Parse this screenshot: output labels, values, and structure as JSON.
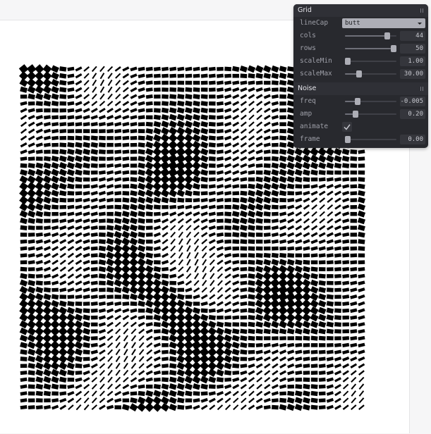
{
  "grid_folder": {
    "title": "Grid",
    "linecap": {
      "label": "lineCap",
      "value": "butt"
    },
    "cols": {
      "label": "cols",
      "value": "44",
      "level": 0.82
    },
    "rows": {
      "label": "rows",
      "value": "50",
      "level": 0.96
    },
    "scale_min": {
      "label": "scaleMin",
      "value": "1.00",
      "level": 0.0
    },
    "scale_max": {
      "label": "scaleMax",
      "value": "30.00",
      "level": 0.28
    }
  },
  "noise_folder": {
    "title": "Noise",
    "freq": {
      "label": "freq",
      "value": "-0.005",
      "level": 0.25
    },
    "amp": {
      "label": "amp",
      "value": "0.20",
      "level": 0.2
    },
    "animate": {
      "label": "animate",
      "checked": true
    },
    "frame": {
      "label": "frame",
      "value": "0.00",
      "level": 0.0
    }
  },
  "colors": {
    "canvas_background": "#ffffff",
    "stroke": "#000000",
    "panel_background": "#28292e"
  }
}
